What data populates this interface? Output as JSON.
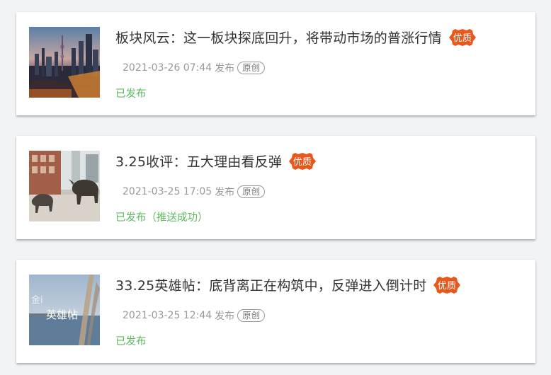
{
  "articles": [
    {
      "title": "板块风云：这一板块探底回升，将带动市场的普涨行情",
      "badge": "优质",
      "published_at": "2021-03-26 07:44",
      "publish_label": "发布",
      "tag": "原创",
      "status": "已发布",
      "thumbnail": "city-skyline-image"
    },
    {
      "title": "3.25收评：五大理由看反弹",
      "badge": "优质",
      "published_at": "2021-03-25 17:05",
      "publish_label": "发布",
      "tag": "原创",
      "status": "已发布（推送成功）",
      "thumbnail": "bull-bear-statues-image"
    },
    {
      "title": "33.25英雄帖：底背离正在构筑中，反弹进入倒计时",
      "badge": "优质",
      "published_at": "2021-03-25 12:44",
      "publish_label": "发布",
      "tag": "原创",
      "status": "已发布",
      "thumbnail": "lakeside-image",
      "thumbnail_text_1": "金i",
      "thumbnail_text_2": "英雄帖"
    }
  ],
  "colors": {
    "badge_bg": "#e8581c",
    "status_green": "#5cb85c",
    "meta_gray": "#999999"
  }
}
